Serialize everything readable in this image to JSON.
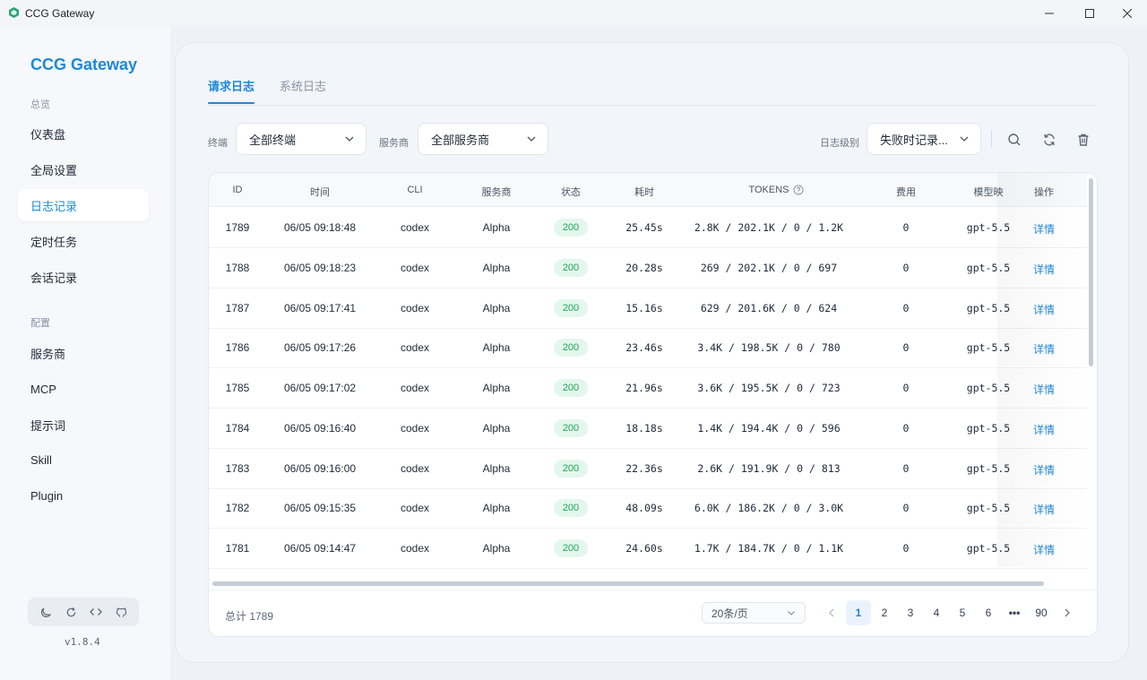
{
  "window": {
    "title": "CCG Gateway"
  },
  "sidebar": {
    "brand": "CCG Gateway",
    "section_overview": "总览",
    "section_config": "配置",
    "items": [
      {
        "label": "仪表盘"
      },
      {
        "label": "全局设置"
      },
      {
        "label": "日志记录"
      },
      {
        "label": "定时任务"
      },
      {
        "label": "会话记录"
      },
      {
        "label": "服务商"
      },
      {
        "label": "MCP"
      },
      {
        "label": "提示词"
      },
      {
        "label": "Skill"
      },
      {
        "label": "Plugin"
      }
    ],
    "active_item": "日志记录",
    "tools": [
      "moon-icon",
      "refresh-icon",
      "code-icon",
      "github-icon"
    ],
    "version": "v1.8.4"
  },
  "tabs": [
    {
      "label": "请求日志",
      "active": true
    },
    {
      "label": "系统日志",
      "active": false
    }
  ],
  "filters": {
    "terminal_label": "终端",
    "terminal_value": "全部终端",
    "provider_label": "服务商",
    "provider_value": "全部服务商",
    "level_label": "日志级别",
    "level_value": "失败时记录..."
  },
  "toolbar_icons": [
    "search-icon",
    "refresh-icon",
    "trash-icon"
  ],
  "table": {
    "columns": [
      "ID",
      "时间",
      "CLI",
      "服务商",
      "状态",
      "耗时",
      "TOKENS",
      "费用",
      "模型映",
      "操作"
    ],
    "rows": [
      [
        "1789",
        "06/05 09:18:48",
        "codex",
        "Alpha",
        "200",
        "25.45s",
        "2.8K / 202.1K / 0 / 1.2K",
        "0",
        "gpt-5.5",
        "详情"
      ],
      [
        "1788",
        "06/05 09:18:23",
        "codex",
        "Alpha",
        "200",
        "20.28s",
        "269 / 202.1K / 0 / 697",
        "0",
        "gpt-5.5",
        "详情"
      ],
      [
        "1787",
        "06/05 09:17:41",
        "codex",
        "Alpha",
        "200",
        "15.16s",
        "629 / 201.6K / 0 / 624",
        "0",
        "gpt-5.5",
        "详情"
      ],
      [
        "1786",
        "06/05 09:17:26",
        "codex",
        "Alpha",
        "200",
        "23.46s",
        "3.4K / 198.5K / 0 / 780",
        "0",
        "gpt-5.5",
        "详情"
      ],
      [
        "1785",
        "06/05 09:17:02",
        "codex",
        "Alpha",
        "200",
        "21.96s",
        "3.6K / 195.5K / 0 / 723",
        "0",
        "gpt-5.5",
        "详情"
      ],
      [
        "1784",
        "06/05 09:16:40",
        "codex",
        "Alpha",
        "200",
        "18.18s",
        "1.4K / 194.4K / 0 / 596",
        "0",
        "gpt-5.5",
        "详情"
      ],
      [
        "1783",
        "06/05 09:16:00",
        "codex",
        "Alpha",
        "200",
        "22.36s",
        "2.6K / 191.9K / 0 / 813",
        "0",
        "gpt-5.5",
        "详情"
      ],
      [
        "1782",
        "06/05 09:15:35",
        "codex",
        "Alpha",
        "200",
        "48.09s",
        "6.0K / 186.2K / 0 / 3.0K",
        "0",
        "gpt-5.5",
        "详情"
      ],
      [
        "1781",
        "06/05 09:14:47",
        "codex",
        "Alpha",
        "200",
        "24.60s",
        "1.7K / 184.7K / 0 / 1.1K",
        "0",
        "gpt-5.5",
        "详情"
      ]
    ]
  },
  "footer": {
    "total": "总计 1789",
    "page_size": "20条/页",
    "pages": [
      "1",
      "2",
      "3",
      "4",
      "5",
      "6",
      "•••",
      "90"
    ],
    "current_page": "1"
  },
  "colors": {
    "accent": "#1e88d6",
    "status_ok_bg": "#e4f7ec",
    "status_ok_text": "#1ea55a"
  }
}
